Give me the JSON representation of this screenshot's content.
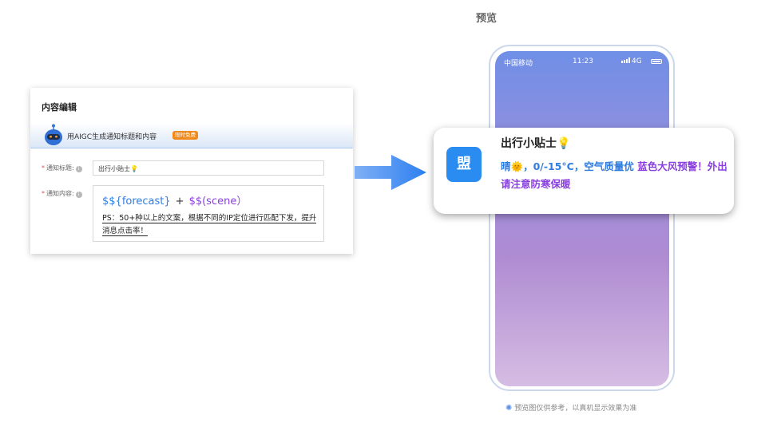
{
  "preview": {
    "title": "预览",
    "footer_note": "预览图仅供参考，以真机显示效果为准"
  },
  "editor": {
    "title": "内容编辑",
    "aigc": {
      "label": "用AIGC生成通知标题和内容",
      "badge": "限时免费"
    },
    "title_field": {
      "label": "通知标题:",
      "value": "出行小贴士💡"
    },
    "content_field": {
      "label": "通知内容:",
      "var_forecast": "$${forecast}",
      "plus": "+",
      "var_scene": "$$(scene）",
      "ps": "PS：50+种以上的文案，根据不同的IP定位进行匹配下发，提升消息点击率！"
    }
  },
  "phone": {
    "carrier": "中国移动",
    "time": "11:23",
    "network": "4G"
  },
  "notification": {
    "app_icon_text": "盟",
    "title": "出行小贴士💡",
    "body_main": "晴🌞，0/-15°C，空气质量优 ",
    "body_warning": "蓝色大风预警！外出请注意防寒保暖"
  },
  "colors": {
    "accent_blue": "#2f7de1",
    "accent_purple": "#8a3fe0",
    "badge_orange": "#f08a1c",
    "app_icon_blue": "#2a8cf0"
  },
  "icons": [
    "robot-icon",
    "info-icon",
    "arrow-right-icon",
    "signal-icon",
    "battery-icon",
    "lightbulb-icon"
  ]
}
